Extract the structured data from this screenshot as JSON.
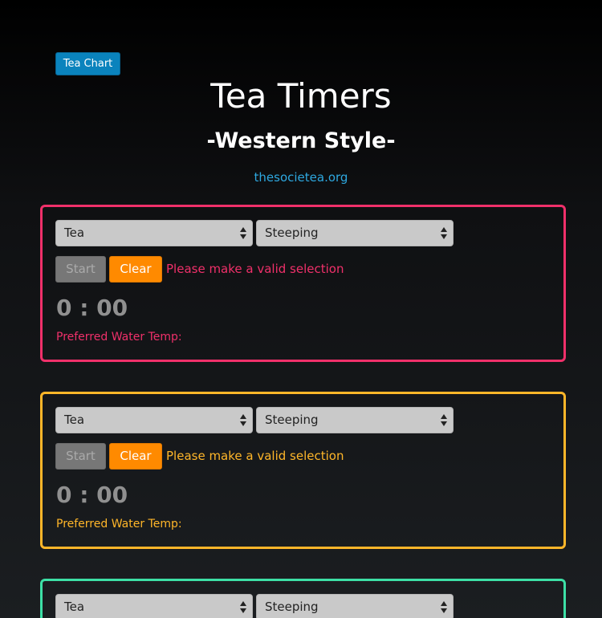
{
  "header": {
    "chart_button": "Tea Chart",
    "title": "Tea Timers",
    "subtitle": "-Western Style-",
    "link": "thesocietea.org"
  },
  "timers": [
    {
      "accent": "#f0306a",
      "tea_select": "Tea",
      "steep_select": "Steeping",
      "start_label": "Start",
      "clear_label": "Clear",
      "message": "Please make a valid selection",
      "time": "0 : 00",
      "temp_label": "Preferred Water Temp:"
    },
    {
      "accent": "#ffb629",
      "tea_select": "Tea",
      "steep_select": "Steeping",
      "start_label": "Start",
      "clear_label": "Clear",
      "message": "Please make a valid selection",
      "time": "0 : 00",
      "temp_label": "Preferred Water Temp:"
    },
    {
      "accent": "#3de0a6",
      "tea_select": "Tea",
      "steep_select": "Steeping"
    }
  ]
}
